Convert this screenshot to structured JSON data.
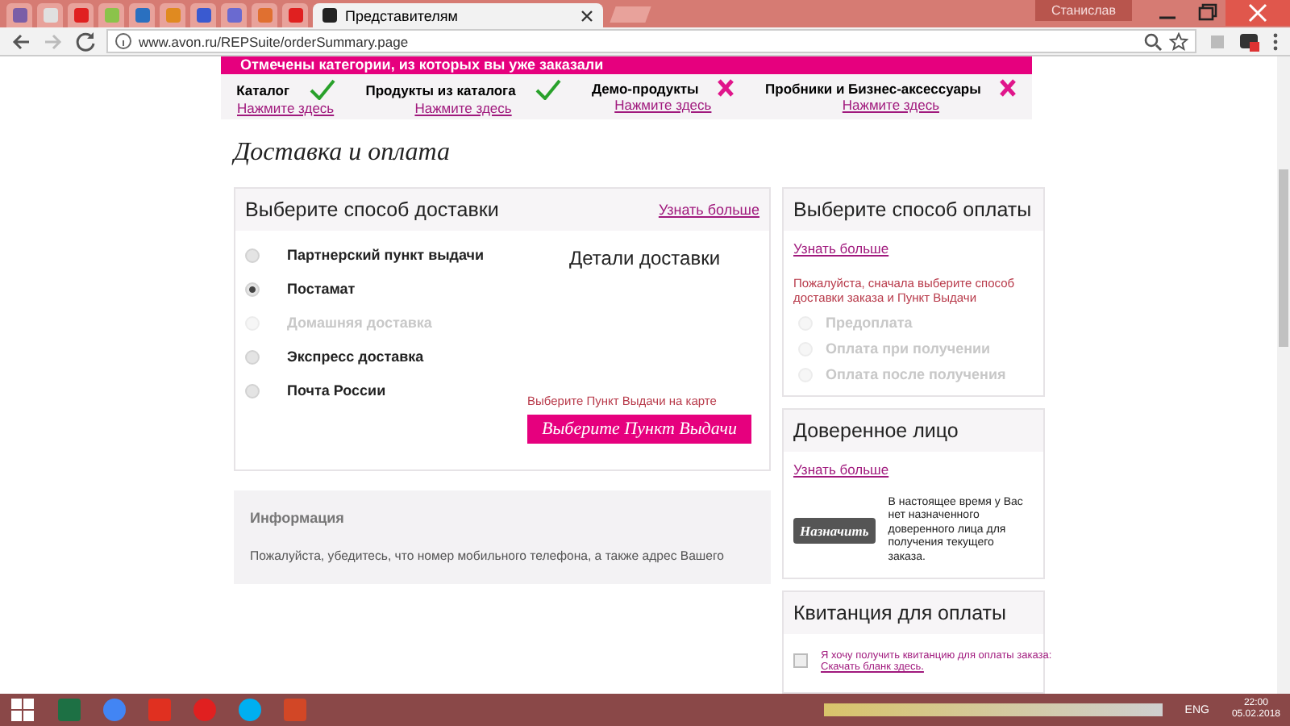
{
  "browser": {
    "tabs": [
      {
        "selected": false,
        "color": "#7b5ea7"
      },
      {
        "selected": false,
        "color": "#e0e0e0"
      },
      {
        "selected": false,
        "color": "#e02020"
      },
      {
        "selected": false,
        "color": "#8bc34a"
      },
      {
        "selected": false,
        "color": "#2a70c0"
      },
      {
        "selected": false,
        "color": "#e08a20"
      },
      {
        "selected": false,
        "color": "#3a5ad0"
      },
      {
        "selected": false,
        "color": "#6a6ad0"
      },
      {
        "selected": false,
        "color": "#e07030"
      },
      {
        "selected": false,
        "color": "#e02020"
      },
      {
        "label": "Представителям",
        "selected": true,
        "color": "#222222"
      }
    ],
    "user": "Станислав",
    "url": "www.avon.ru/REPSuite/orderSummary.page"
  },
  "categories": {
    "title": "Отмечены категории, из которых вы уже заказали",
    "items": [
      {
        "label": "Каталог",
        "ordered": true,
        "link": "Нажмите здесь"
      },
      {
        "label": "Продукты из каталога",
        "ordered": true,
        "link": "Нажмите здесь"
      },
      {
        "label": "Демо-продукты",
        "ordered": false,
        "link": "Нажмите здесь"
      },
      {
        "label": "Пробники и Бизнес-аксессуары",
        "ordered": false,
        "link": "Нажмите здесь"
      }
    ]
  },
  "heading": "Доставка и оплата",
  "delivery": {
    "title": "Выберите способ доставки",
    "more": "Узнать больше",
    "details_title": "Детали доставки",
    "options": [
      {
        "label": "Партнерский пункт выдачи",
        "selected": false,
        "disabled": false
      },
      {
        "label": "Постамат",
        "selected": true,
        "disabled": false
      },
      {
        "label": "Домашняя доставка",
        "selected": false,
        "disabled": true
      },
      {
        "label": "Экспресс доставка",
        "selected": false,
        "disabled": false
      },
      {
        "label": "Почта России",
        "selected": false,
        "disabled": false
      }
    ],
    "map_hint": "Выберите Пункт Выдачи на карте",
    "map_button": "Выберите Пункт Выдачи"
  },
  "info": {
    "title": "Информация",
    "text": "Пожалуйста, убедитесь, что номер мобильного телефона, а также адрес Вашего"
  },
  "payment": {
    "title": "Выберите способ оплаты",
    "more": "Узнать больше",
    "warning": "Пожалуйста, сначала выберите способ доставки заказа и Пункт Выдачи",
    "options": [
      {
        "label": "Предоплата",
        "selected": false,
        "disabled": true
      },
      {
        "label": "Оплата при получении",
        "selected": false,
        "disabled": true
      },
      {
        "label": "Оплата после получения",
        "selected": false,
        "disabled": true
      }
    ]
  },
  "trustee": {
    "title": "Доверенное лицо",
    "more": "Узнать больше",
    "button": "Назначить",
    "text": "В настоящее время у Вас нет назначенного доверенного лица для получения текущего заказа."
  },
  "receipt": {
    "title": "Квитанция для оплаты",
    "checked": false,
    "text": "Я хочу получить квитанцию для оплаты заказа:",
    "link": "Скачать бланк здесь."
  },
  "taskbar": {
    "apps": [
      {
        "kind": "excel",
        "color": "#1d7044"
      },
      {
        "kind": "chrome",
        "color": "#4285f4"
      },
      {
        "kind": "yandex",
        "color": "#e03020"
      },
      {
        "kind": "ybrowser",
        "color": "#e02020"
      },
      {
        "kind": "skype",
        "color": "#00aff0"
      },
      {
        "kind": "powerpoint",
        "color": "#d24726"
      }
    ],
    "lang": "ENG",
    "time": "22:00",
    "date": "05.02.2018"
  }
}
